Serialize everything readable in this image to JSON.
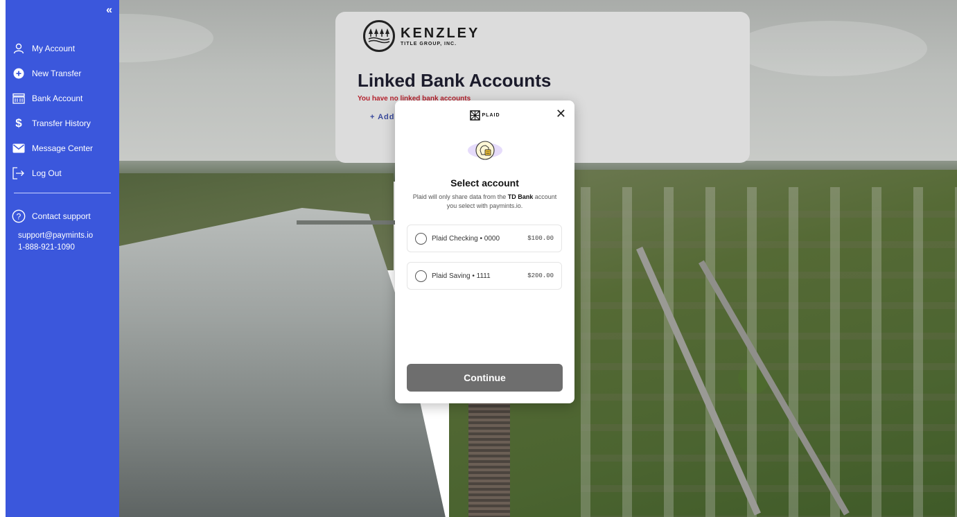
{
  "sidebar": {
    "collapse_label": "«",
    "items": [
      {
        "label": "My Account",
        "icon": "user-icon"
      },
      {
        "label": "New Transfer",
        "icon": "plus-circle-icon"
      },
      {
        "label": "Bank Account",
        "icon": "bank-icon"
      },
      {
        "label": "Transfer History",
        "icon": "dollar-icon"
      },
      {
        "label": "Message Center",
        "icon": "envelope-icon"
      },
      {
        "label": "Log Out",
        "icon": "logout-icon"
      }
    ],
    "support": {
      "label": "Contact support",
      "icon": "question-circle-icon",
      "email": "support@paymints.io",
      "phone": "1-888-921-1090"
    },
    "color": "#3b57dc"
  },
  "card": {
    "logo_name": "KENZLEY",
    "logo_sub": "TITLE GROUP, INC.",
    "title": "Linked Bank Accounts",
    "warning": "You have no linked bank accounts",
    "add_label": "+ Add"
  },
  "modal": {
    "brand": "PLAID",
    "close_label": "✕",
    "title": "Select account",
    "desc_before": "Plaid will only share data from the ",
    "desc_bank": "TD Bank",
    "desc_after": " account you select with paymints.io.",
    "accounts": [
      {
        "name": "Plaid Checking • 0000",
        "balance": "$100.00"
      },
      {
        "name": "Plaid Saving • 1111",
        "balance": "$200.00"
      }
    ],
    "continue_label": "Continue"
  }
}
